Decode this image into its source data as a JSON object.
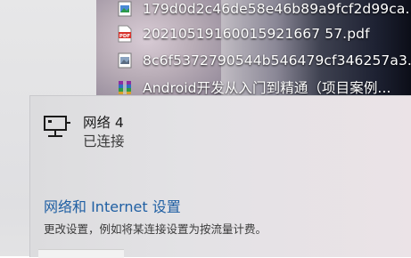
{
  "desktop": {
    "files": [
      {
        "name": "179d0d2c46de58e46b89a9fcf2d99ca...",
        "icon": "image-file-icon"
      },
      {
        "name": "20210519160015921667 57.pdf",
        "icon": "pdf-file-icon"
      },
      {
        "name": "8c6f5372790544b546479cf346257a3...",
        "icon": "image-file-icon"
      },
      {
        "name": "Android开发从入门到精通（项目案例...",
        "icon": "rar-archive-icon"
      }
    ]
  },
  "network_flyout": {
    "network_name": "网络 4",
    "network_status": "已连接",
    "settings_link": "网络和 Internet 设置",
    "settings_description": "更改设置，例如将某连接设置为按流量计费。"
  },
  "colors": {
    "link": "#1f5fa3",
    "pdf_red": "#d8312b"
  }
}
